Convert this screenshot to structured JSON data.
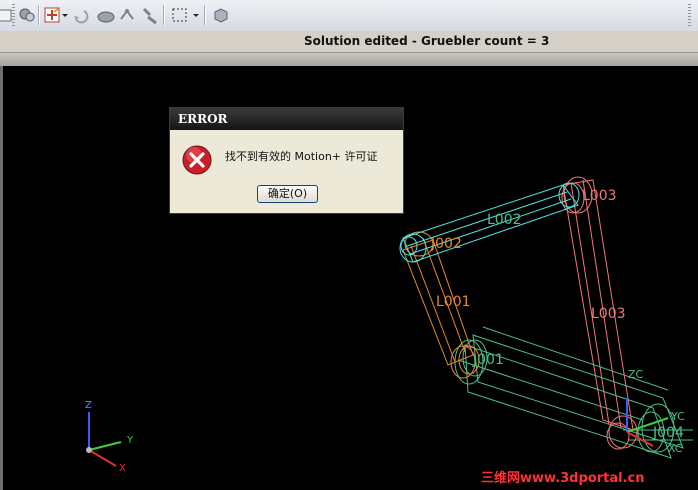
{
  "toolbar": {
    "buttons": [
      "folder-icon",
      "animation-icon",
      "snap-point-icon",
      "undo-icon",
      "sheet-body-icon",
      "move-icon",
      "tool-icon",
      "select-box-icon",
      "solid-icon"
    ]
  },
  "status": {
    "text": "Solution edited - Gruebler count = 3"
  },
  "scene": {
    "labels": {
      "l002": "L002",
      "l003": "L003",
      "l003b": "L003",
      "l001": "L001",
      "j002": "J002",
      "j001": "J001",
      "j004": "J004",
      "zc": "ZC",
      "yc": "YC",
      "xc": "XC"
    },
    "triad": {
      "z": "Z",
      "y": "Y",
      "x": "X"
    }
  },
  "dialog": {
    "title": "ERROR",
    "message": "找不到有效的 Motion+ 许可证",
    "ok_label": "确定(O)"
  },
  "watermark": "三维网www.3dportal.cn",
  "colors": {
    "cyan_link": "#4fe0e6",
    "orange_link": "#e58a2e",
    "pink_link": "#f07878",
    "green_link": "#4fbf8a"
  }
}
